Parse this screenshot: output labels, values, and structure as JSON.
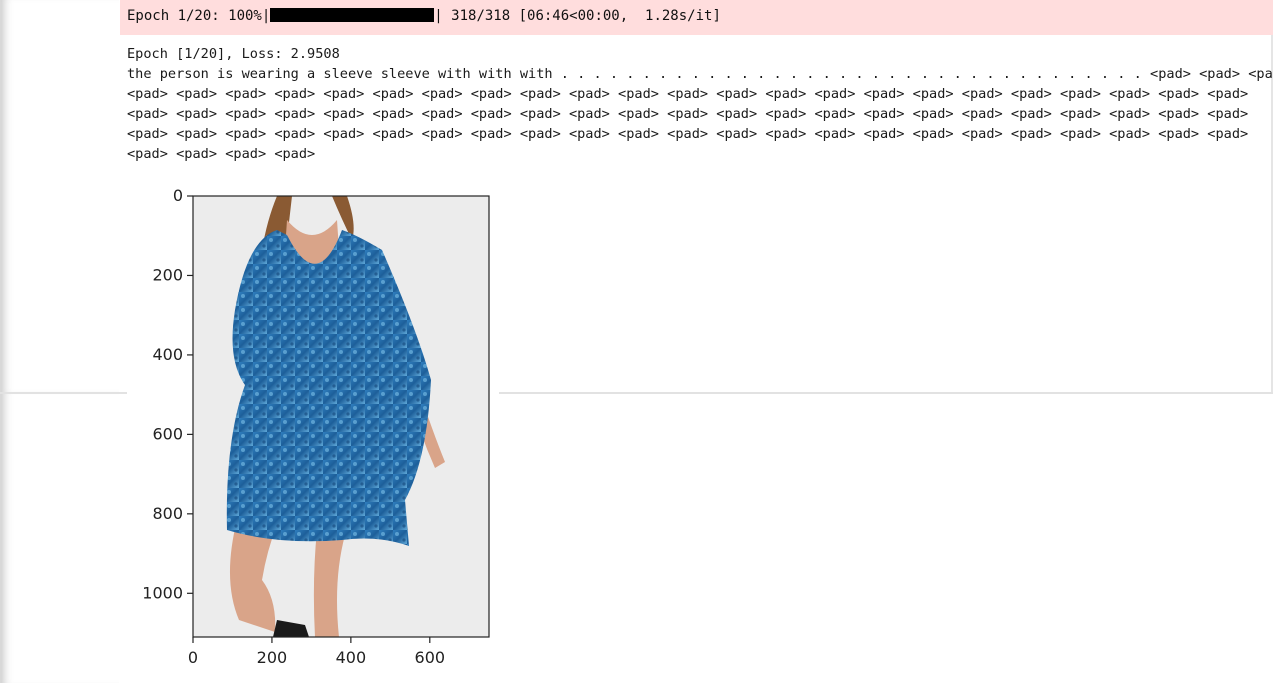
{
  "progress": {
    "prefix": "Epoch 1/20: 100%",
    "fraction": 1.0,
    "suffix": " 318/318 [06:46<00:00,  1.28s/it]"
  },
  "output": {
    "epoch_line": "Epoch [1/20], Loss: 2.9508",
    "caption_lines": [
      "the person is wearing a sleeve sleeve with with with . . . . . . . . . . . . . . . . . . . . . . . . . . . . . . . . . . . . <pad> <pad> <pad>",
      "<pad> <pad> <pad> <pad> <pad> <pad> <pad> <pad> <pad> <pad> <pad> <pad> <pad> <pad> <pad> <pad> <pad> <pad> <pad> <pad> <pad> <pad> <pad>",
      "<pad> <pad> <pad> <pad> <pad> <pad> <pad> <pad> <pad> <pad> <pad> <pad> <pad> <pad> <pad> <pad> <pad> <pad> <pad> <pad> <pad> <pad> <pad>",
      "<pad> <pad> <pad> <pad> <pad> <pad> <pad> <pad> <pad> <pad> <pad> <pad> <pad> <pad> <pad> <pad> <pad> <pad> <pad> <pad> <pad> <pad> <pad>",
      "<pad> <pad> <pad> <pad>"
    ]
  },
  "plot": {
    "y_ticks": [
      "0",
      "200",
      "400",
      "600",
      "800",
      "1000"
    ],
    "x_ticks": [
      "0",
      "200",
      "400",
      "600"
    ],
    "image_desc_icon": "dress-photo-icon",
    "colors": {
      "dress_dark": "#1d5f9a",
      "dress_mid": "#2f7fbf",
      "dress_light": "#5fa8d8",
      "skin": "#d9a489",
      "hair": "#8a5a33",
      "backdrop": "#ececec"
    }
  }
}
